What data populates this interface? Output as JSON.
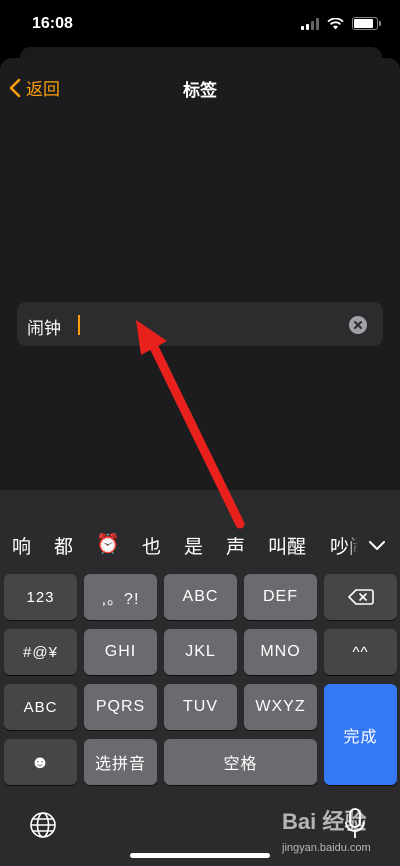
{
  "status_bar": {
    "time": "16:08"
  },
  "nav": {
    "back_label": "返回",
    "title": "标签"
  },
  "label_field": {
    "value": "闹钟"
  },
  "candidates": [
    "响",
    "都",
    "⏰",
    "也",
    "是",
    "声",
    "叫醒",
    "吵闹"
  ],
  "keyboard": {
    "row1": [
      "123",
      ",。?!",
      "ABC",
      "DEF"
    ],
    "row2": [
      "#@¥",
      "GHI",
      "JKL",
      "MNO",
      "^^"
    ],
    "row3": [
      "ABC",
      "PQRS",
      "TUV",
      "WXYZ"
    ],
    "row4": [
      "☻",
      "选拼音",
      "空格"
    ],
    "done_label": "完成"
  },
  "watermark": {
    "brand": "Bai 经验",
    "site": "jingyan.baidu.com"
  },
  "colors": {
    "accent": "#ff9f0a",
    "done_key": "#3478f6",
    "arrow": "#e8211d"
  }
}
